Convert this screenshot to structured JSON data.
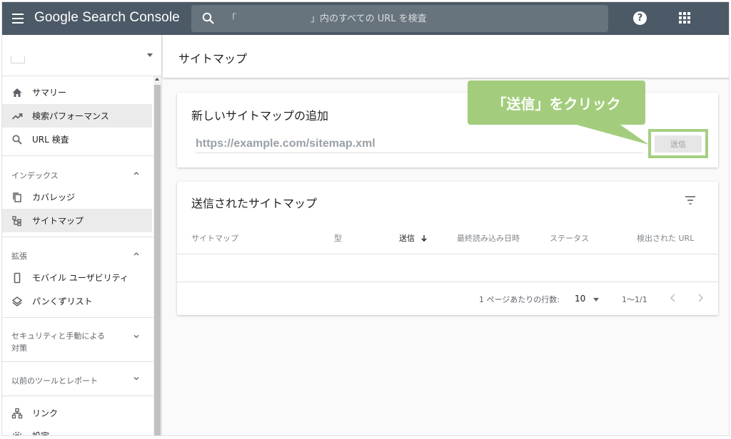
{
  "app": {
    "title": "Google Search Console"
  },
  "search": {
    "placeholder": "「　　　　　　　　」内のすべての URL を検査"
  },
  "header": {
    "help_glyph": "?"
  },
  "sidebar": {
    "items": [
      {
        "label": "サマリー",
        "icon": "home-icon"
      },
      {
        "label": "検索パフォーマンス",
        "icon": "trending-up-icon",
        "active": true
      },
      {
        "label": "URL 検査",
        "icon": "search-icon"
      }
    ],
    "sections": [
      {
        "label": "インデックス",
        "expanded": true,
        "items": [
          {
            "label": "カバレッジ",
            "icon": "copy-icon"
          },
          {
            "label": "サイトマップ",
            "icon": "sitemap-icon",
            "active": true
          }
        ]
      },
      {
        "label": "拡張",
        "expanded": true,
        "items": [
          {
            "label": "モバイル ユーザビリティ",
            "icon": "smartphone-icon"
          },
          {
            "label": "パンくずリスト",
            "icon": "layers-icon"
          }
        ]
      },
      {
        "label_line1": "セキュリティと手動による",
        "label_line2": "対策",
        "expanded": false
      },
      {
        "label": "以前のツールとレポート",
        "expanded": false
      }
    ],
    "bottom_items": [
      {
        "label": "リンク",
        "icon": "link-tree-icon"
      },
      {
        "label": "設定",
        "icon": "gear-icon"
      }
    ]
  },
  "main": {
    "page_title": "サイトマップ",
    "add_card": {
      "title": "新しいサイトマップの追加",
      "input_placeholder": "https://example.com/sitemap.xml",
      "submit_label": "送信"
    },
    "callout": {
      "text": "「送信」をクリック",
      "color": "#a3cd7d"
    },
    "submitted_card": {
      "title": "送信されたサイトマップ",
      "columns": [
        "サイトマップ",
        "型",
        "送信",
        "最終読み込み日時",
        "ステータス",
        "検出された URL"
      ],
      "sorted_column": "送信",
      "rows": [],
      "pager": {
        "rows_per_page_label": "1 ページあたりの行数:",
        "rows_per_page": "10",
        "range": "1〜1/1"
      }
    }
  },
  "colors": {
    "topbar": "#4b5a66",
    "search_bg": "#68747d",
    "highlight_green": "#a6cf82"
  }
}
